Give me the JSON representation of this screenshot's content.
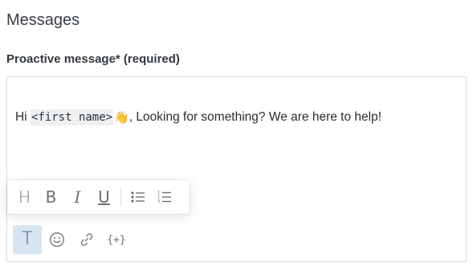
{
  "section": {
    "title": "Messages"
  },
  "field": {
    "label": "Proactive message* (required)",
    "message": {
      "greeting": "Hi ",
      "placeholder": "<first name>",
      "emoji": "👋",
      "rest": ", Looking for something? We are here to help!"
    }
  },
  "format_toolbar": {
    "heading": "H",
    "bold": "B",
    "italic": "I",
    "underline": "U",
    "bullet_list_icon": "bullet-list-icon",
    "numbered_list_icon": "numbered-list-icon"
  },
  "insert_toolbar": {
    "text_format": "T",
    "emoji_icon": "smiley-icon",
    "link_icon": "link-icon",
    "variable": "{+}",
    "active_item": "text_format"
  },
  "colors": {
    "border": "#d6dadd",
    "active_bg": "#d7e5f1",
    "placeholder_bg": "#eef0f1"
  }
}
